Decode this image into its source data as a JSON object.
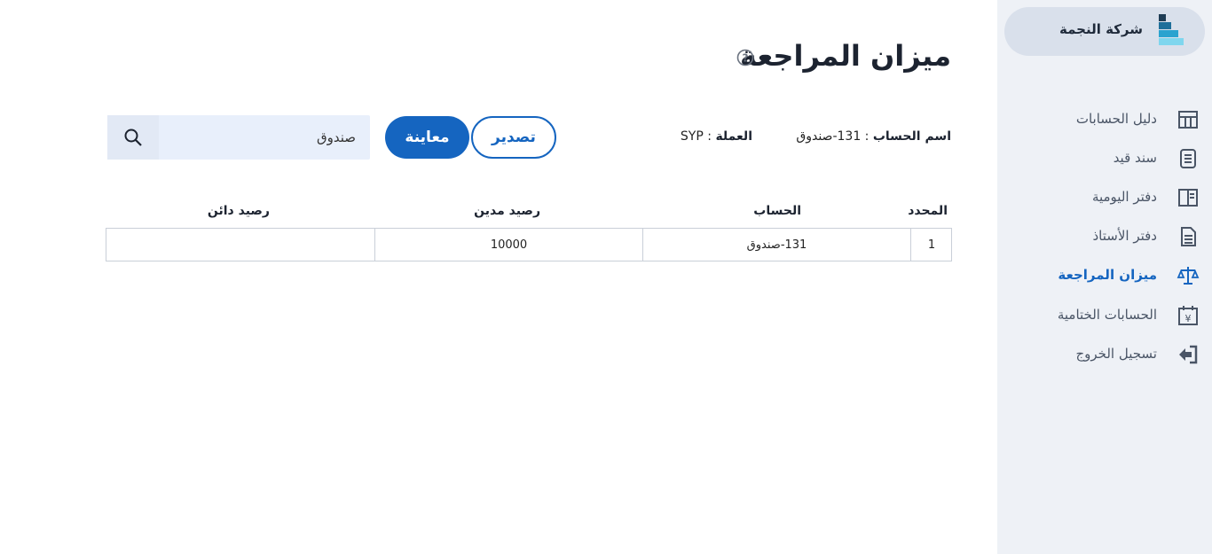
{
  "sidebar": {
    "brand_name": "شركة النجمة",
    "items": [
      {
        "label": "دليل الحسابات",
        "icon": "table-icon"
      },
      {
        "label": "سند قيد",
        "icon": "document-list-icon"
      },
      {
        "label": "دفتر اليومية",
        "icon": "book-icon"
      },
      {
        "label": "دفتر الأستاذ",
        "icon": "ledger-icon"
      },
      {
        "label": "ميزان المراجعة",
        "icon": "scale-icon",
        "active": true
      },
      {
        "label": "الحسابات الختامية",
        "icon": "calendar-yen-icon"
      },
      {
        "label": "تسجيل الخروج",
        "icon": "logout-icon"
      }
    ],
    "accent_color": "#1565c0"
  },
  "page": {
    "title": "ميزان المراجعة",
    "account_label": "اسم الحساب",
    "account_value": ": 131-صندوق",
    "currency_label": "العملة",
    "currency_value": ": SYP",
    "export_label": "تصدير",
    "preview_label": "معاينة",
    "search_value": "صندوق"
  },
  "table": {
    "headers": [
      "المحدد",
      "الحساب",
      "رصيد مدين",
      "رصيد دائن"
    ],
    "rows": [
      [
        "1",
        "131-صندوق",
        "10000",
        ""
      ]
    ]
  }
}
